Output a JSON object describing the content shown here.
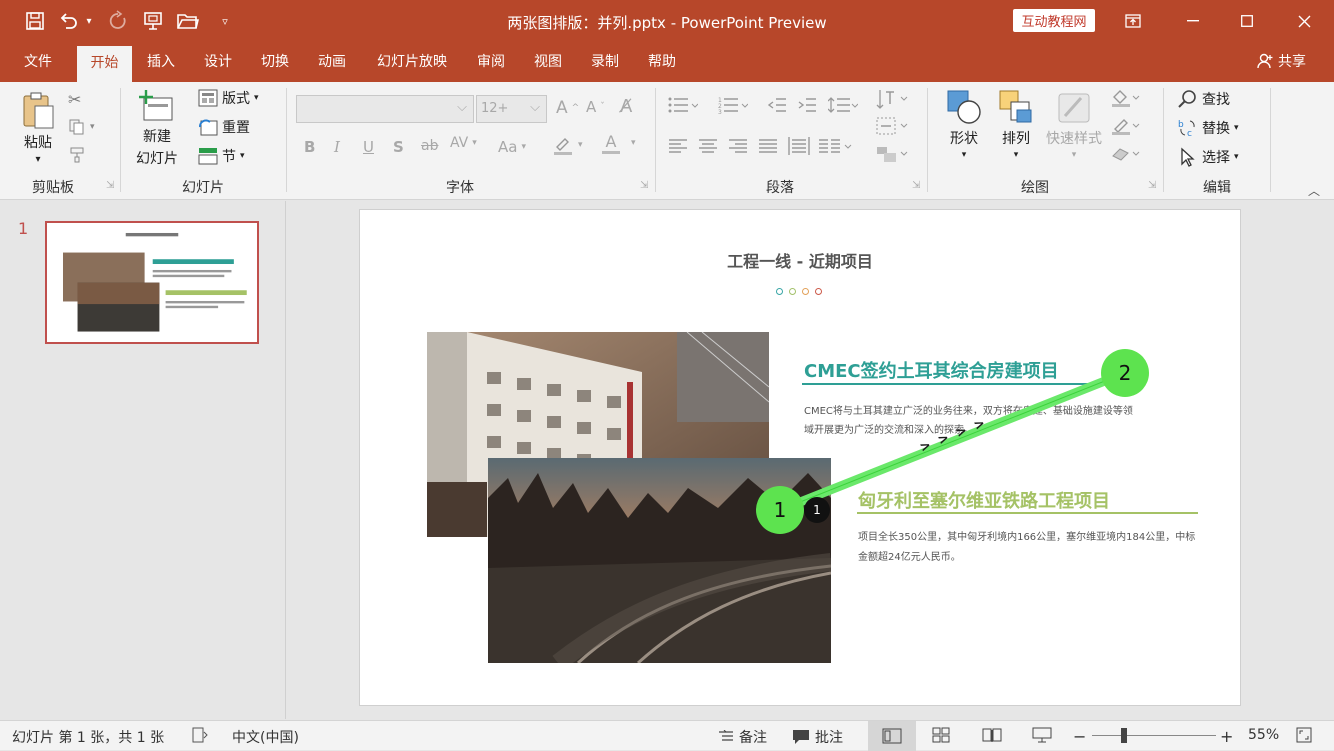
{
  "titlebar": {
    "title": "两张图排版：并列.pptx  -  PowerPoint Preview",
    "badge": "互动教程网"
  },
  "tabs": [
    "文件",
    "开始",
    "插入",
    "设计",
    "切换",
    "动画",
    "幻灯片放映",
    "审阅",
    "视图",
    "录制",
    "帮助"
  ],
  "share": "共享",
  "ribbon": {
    "clipboard": {
      "paste": "粘贴",
      "label": "剪贴板"
    },
    "slides": {
      "new_slide_line1": "新建",
      "new_slide_line2": "幻灯片",
      "layout": "版式",
      "reset": "重置",
      "section": "节",
      "label": "幻灯片"
    },
    "font": {
      "font_size": "12+",
      "label": "字体"
    },
    "paragraph": {
      "label": "段落"
    },
    "drawing": {
      "shapes": "形状",
      "arrange": "排列",
      "quick_styles": "快速样式",
      "label": "绘图"
    },
    "editing": {
      "find": "查找",
      "replace": "替换",
      "select": "选择",
      "label": "编辑"
    }
  },
  "thumbnail": {
    "number": "1"
  },
  "slide": {
    "title": "工程一线 - 近期项目",
    "dot_colors": [
      "#3aa6a6",
      "#a3c16b",
      "#e2a15a",
      "#cc5a4a"
    ],
    "item1": {
      "heading": "CMEC签约土耳其综合房建项目",
      "body": "CMEC将与土耳其建立广泛的业务往来，双方将在房建、基础设施建设等领域开展更为广泛的交流和深入的探索。",
      "color": "#2e9f95"
    },
    "item2": {
      "heading": "匈牙利至塞尔维亚铁路工程项目",
      "body": "项目全长350公里，其中匈牙利境内166公里，塞尔维亚境内184公里，中标金额超24亿元人民币。",
      "color": "#a5c266"
    },
    "marker1": "1",
    "marker2": "2",
    "marker_small": "1",
    "chevrons": "> > > >"
  },
  "status": {
    "slide_info": "幻灯片 第 1 张，共 1 张",
    "language": "中文(中国)",
    "notes": "备注",
    "comments": "批注",
    "zoom": "55%"
  }
}
